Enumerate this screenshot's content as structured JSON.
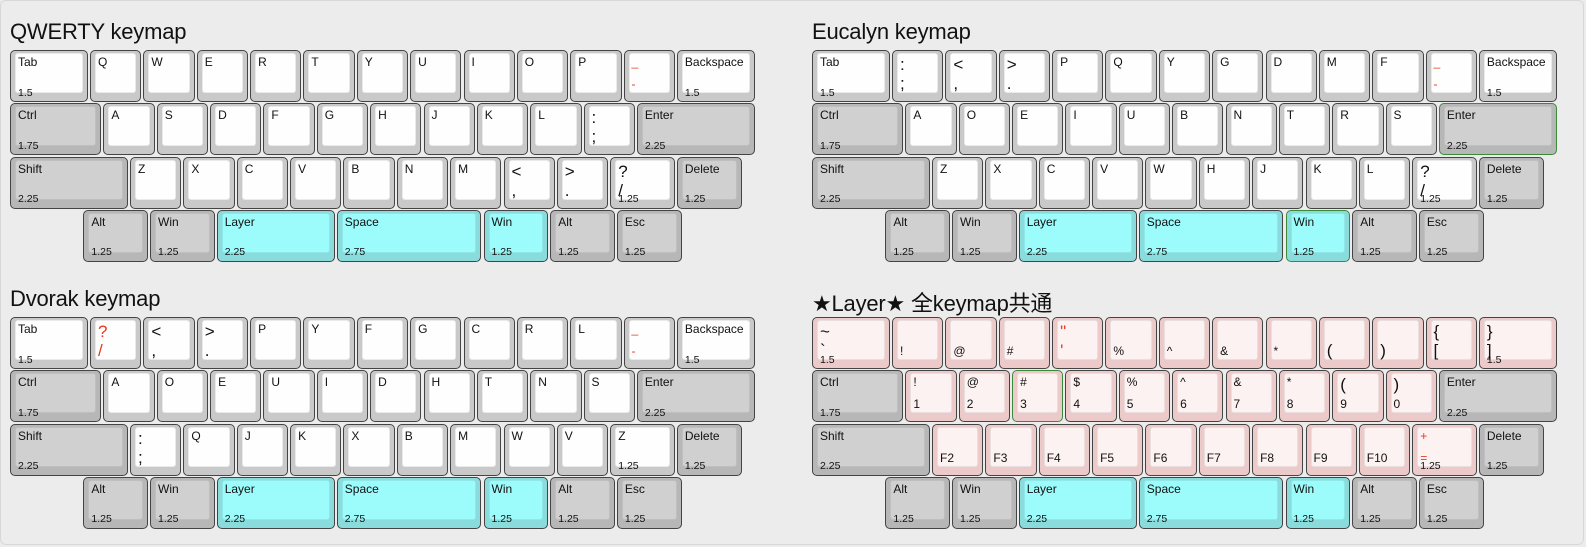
{
  "panels": [
    {
      "title": "QWERTY keymap",
      "rows": [
        [
          {
            "t": "Tab",
            "w": "1.5",
            "u": 1.5
          },
          {
            "t": "Q"
          },
          {
            "t": "W"
          },
          {
            "t": "E"
          },
          {
            "t": "R"
          },
          {
            "t": "T"
          },
          {
            "t": "Y"
          },
          {
            "t": "U"
          },
          {
            "t": "I"
          },
          {
            "t": "O"
          },
          {
            "t": "P"
          },
          {
            "t": "_",
            "b": "-",
            "red": true
          },
          {
            "t": "Backspace",
            "w": "1.5",
            "u": 1.5
          }
        ],
        [
          {
            "t": "Ctrl",
            "w": "1.75",
            "u": 1.75,
            "kind": "mod"
          },
          {
            "t": "A"
          },
          {
            "t": "S"
          },
          {
            "t": "D"
          },
          {
            "t": "F"
          },
          {
            "t": "G"
          },
          {
            "t": "H"
          },
          {
            "t": "J"
          },
          {
            "t": "K"
          },
          {
            "t": "L"
          },
          {
            "t": ":",
            "b": ";"
          },
          {
            "t": "Enter",
            "w": "2.25",
            "u": 2.25,
            "kind": "mod"
          }
        ],
        [
          {
            "t": "Shift",
            "w": "2.25",
            "u": 2.25,
            "kind": "mod"
          },
          {
            "t": "Z"
          },
          {
            "t": "X"
          },
          {
            "t": "C"
          },
          {
            "t": "V"
          },
          {
            "t": "B"
          },
          {
            "t": "N"
          },
          {
            "t": "M"
          },
          {
            "t": "<",
            "b": ","
          },
          {
            "t": ">",
            "b": "."
          },
          {
            "t": "?",
            "b": "/",
            "w": "1.25",
            "u": 1.25
          },
          {
            "t": "Delete",
            "w": "1.25",
            "u": 1.25,
            "kind": "mod"
          }
        ],
        [
          {
            "offset": 1.375
          },
          {
            "t": "Alt",
            "w": "1.25",
            "u": 1.25,
            "kind": "mod"
          },
          {
            "t": "Win",
            "w": "1.25",
            "u": 1.25,
            "kind": "mod"
          },
          {
            "t": "Layer",
            "w": "2.25",
            "u": 2.25,
            "kind": "layer"
          },
          {
            "t": "Space",
            "w": "2.75",
            "u": 2.75,
            "kind": "layer"
          },
          {
            "t": "Win",
            "w": "1.25",
            "u": 1.25,
            "kind": "layer"
          },
          {
            "t": "Alt",
            "w": "1.25",
            "u": 1.25,
            "kind": "mod"
          },
          {
            "t": "Esc",
            "w": "1.25",
            "u": 1.25,
            "kind": "mod"
          }
        ]
      ]
    },
    {
      "title": "Eucalyn keymap",
      "rows": [
        [
          {
            "t": "Tab",
            "w": "1.5",
            "u": 1.5
          },
          {
            "t": ":",
            "b": ";"
          },
          {
            "t": "<",
            "b": ","
          },
          {
            "t": ">",
            "b": "."
          },
          {
            "t": "P"
          },
          {
            "t": "Q"
          },
          {
            "t": "Y"
          },
          {
            "t": "G"
          },
          {
            "t": "D"
          },
          {
            "t": "M"
          },
          {
            "t": "F"
          },
          {
            "t": "_",
            "b": "-",
            "red": true
          },
          {
            "t": "Backspace",
            "w": "1.5",
            "u": 1.5
          }
        ],
        [
          {
            "t": "Ctrl",
            "w": "1.75",
            "u": 1.75,
            "kind": "mod"
          },
          {
            "t": "A"
          },
          {
            "t": "O"
          },
          {
            "t": "E"
          },
          {
            "t": "I"
          },
          {
            "t": "U"
          },
          {
            "t": "B"
          },
          {
            "t": "N"
          },
          {
            "t": "T"
          },
          {
            "t": "R"
          },
          {
            "t": "S"
          },
          {
            "t": "Enter",
            "w": "2.25",
            "u": 2.25,
            "kind": "mod",
            "hl": true
          }
        ],
        [
          {
            "t": "Shift",
            "w": "2.25",
            "u": 2.25,
            "kind": "mod"
          },
          {
            "t": "Z"
          },
          {
            "t": "X"
          },
          {
            "t": "C"
          },
          {
            "t": "V"
          },
          {
            "t": "W"
          },
          {
            "t": "H"
          },
          {
            "t": "J"
          },
          {
            "t": "K"
          },
          {
            "t": "L"
          },
          {
            "t": "?",
            "b": "/",
            "w": "1.25",
            "u": 1.25
          },
          {
            "t": "Delete",
            "w": "1.25",
            "u": 1.25,
            "kind": "mod"
          }
        ],
        [
          {
            "offset": 1.375
          },
          {
            "t": "Alt",
            "w": "1.25",
            "u": 1.25,
            "kind": "mod"
          },
          {
            "t": "Win",
            "w": "1.25",
            "u": 1.25,
            "kind": "mod"
          },
          {
            "t": "Layer",
            "w": "2.25",
            "u": 2.25,
            "kind": "layer"
          },
          {
            "t": "Space",
            "w": "2.75",
            "u": 2.75,
            "kind": "layer"
          },
          {
            "t": "Win",
            "w": "1.25",
            "u": 1.25,
            "kind": "layer",
            "hl": true
          },
          {
            "t": "Alt",
            "w": "1.25",
            "u": 1.25,
            "kind": "mod"
          },
          {
            "t": "Esc",
            "w": "1.25",
            "u": 1.25,
            "kind": "mod"
          }
        ]
      ]
    },
    {
      "title": "Dvorak keymap",
      "rows": [
        [
          {
            "t": "Tab",
            "w": "1.5",
            "u": 1.5
          },
          {
            "t": "?",
            "b": "/",
            "red": true
          },
          {
            "t": "<",
            "b": ","
          },
          {
            "t": ">",
            "b": "."
          },
          {
            "t": "P"
          },
          {
            "t": "Y"
          },
          {
            "t": "F"
          },
          {
            "t": "G"
          },
          {
            "t": "C"
          },
          {
            "t": "R"
          },
          {
            "t": "L"
          },
          {
            "t": "_",
            "b": "-",
            "red": true
          },
          {
            "t": "Backspace",
            "w": "1.5",
            "u": 1.5
          }
        ],
        [
          {
            "t": "Ctrl",
            "w": "1.75",
            "u": 1.75,
            "kind": "mod"
          },
          {
            "t": "A"
          },
          {
            "t": "O"
          },
          {
            "t": "E"
          },
          {
            "t": "U"
          },
          {
            "t": "I"
          },
          {
            "t": "D"
          },
          {
            "t": "H"
          },
          {
            "t": "T"
          },
          {
            "t": "N"
          },
          {
            "t": "S"
          },
          {
            "t": "Enter",
            "w": "2.25",
            "u": 2.25,
            "kind": "mod"
          }
        ],
        [
          {
            "t": "Shift",
            "w": "2.25",
            "u": 2.25,
            "kind": "mod"
          },
          {
            "t": ":",
            "b": ";"
          },
          {
            "t": "Q"
          },
          {
            "t": "J"
          },
          {
            "t": "K"
          },
          {
            "t": "X"
          },
          {
            "t": "B"
          },
          {
            "t": "M"
          },
          {
            "t": "W"
          },
          {
            "t": "V"
          },
          {
            "t": "Z",
            "w": "1.25",
            "u": 1.25
          },
          {
            "t": "Delete",
            "w": "1.25",
            "u": 1.25,
            "kind": "mod"
          }
        ],
        [
          {
            "offset": 1.375
          },
          {
            "t": "Alt",
            "w": "1.25",
            "u": 1.25,
            "kind": "mod"
          },
          {
            "t": "Win",
            "w": "1.25",
            "u": 1.25,
            "kind": "mod"
          },
          {
            "t": "Layer",
            "w": "2.25",
            "u": 2.25,
            "kind": "layer"
          },
          {
            "t": "Space",
            "w": "2.75",
            "u": 2.75,
            "kind": "layer"
          },
          {
            "t": "Win",
            "w": "1.25",
            "u": 1.25,
            "kind": "layer"
          },
          {
            "t": "Alt",
            "w": "1.25",
            "u": 1.25,
            "kind": "mod"
          },
          {
            "t": "Esc",
            "w": "1.25",
            "u": 1.25,
            "kind": "mod"
          }
        ]
      ]
    },
    {
      "title": "★Layer★ 全keymap共通",
      "rows": [
        [
          {
            "t": "~",
            "b": "`",
            "w": "1.5",
            "u": 1.5,
            "kind": "sym"
          },
          {
            "b": "!",
            "kind": "sym"
          },
          {
            "b": "@",
            "kind": "sym"
          },
          {
            "b": "#",
            "kind": "sym"
          },
          {
            "t": "\"",
            "b": "'",
            "kind": "sym",
            "red": true
          },
          {
            "b": "%",
            "kind": "sym"
          },
          {
            "b": "^",
            "kind": "sym"
          },
          {
            "b": "&",
            "kind": "sym"
          },
          {
            "b": "*",
            "kind": "sym"
          },
          {
            "b": "(",
            "kind": "sym"
          },
          {
            "b": ")",
            "kind": "sym"
          },
          {
            "t": "{",
            "b": "[",
            "kind": "sym"
          },
          {
            "t": "}",
            "b": "]",
            "w": "1.5",
            "u": 1.5,
            "kind": "sym"
          }
        ],
        [
          {
            "t": "Ctrl",
            "w": "1.75",
            "u": 1.75,
            "kind": "mod"
          },
          {
            "t": "!",
            "b": "1",
            "kind": "sym"
          },
          {
            "t": "@",
            "b": "2",
            "kind": "sym"
          },
          {
            "t": "#",
            "b": "3",
            "kind": "sym",
            "hl": true
          },
          {
            "t": "$",
            "b": "4",
            "kind": "sym"
          },
          {
            "t": "%",
            "b": "5",
            "kind": "sym"
          },
          {
            "t": "^",
            "b": "6",
            "kind": "sym"
          },
          {
            "t": "&",
            "b": "7",
            "kind": "sym"
          },
          {
            "t": "*",
            "b": "8",
            "kind": "sym"
          },
          {
            "t": "(",
            "b": "9",
            "kind": "sym"
          },
          {
            "t": ")",
            "b": "0",
            "kind": "sym"
          },
          {
            "t": "Enter",
            "w": "2.25",
            "u": 2.25,
            "kind": "mod"
          }
        ],
        [
          {
            "t": "Shift",
            "w": "2.25",
            "u": 2.25,
            "kind": "mod"
          },
          {
            "b": "F2",
            "kind": "sym"
          },
          {
            "b": "F3",
            "kind": "sym"
          },
          {
            "b": "F4",
            "kind": "sym"
          },
          {
            "b": "F5",
            "kind": "sym"
          },
          {
            "b": "F6",
            "kind": "sym"
          },
          {
            "b": "F7",
            "kind": "sym"
          },
          {
            "b": "F8",
            "kind": "sym"
          },
          {
            "b": "F9",
            "kind": "sym"
          },
          {
            "b": "F10",
            "kind": "sym"
          },
          {
            "t": "+",
            "b": "=",
            "w": "1.25",
            "u": 1.25,
            "kind": "sym",
            "red": true
          },
          {
            "t": "Delete",
            "w": "1.25",
            "u": 1.25,
            "kind": "mod"
          }
        ],
        [
          {
            "offset": 1.375
          },
          {
            "t": "Alt",
            "w": "1.25",
            "u": 1.25,
            "kind": "mod"
          },
          {
            "t": "Win",
            "w": "1.25",
            "u": 1.25,
            "kind": "mod"
          },
          {
            "t": "Layer",
            "w": "2.25",
            "u": 2.25,
            "kind": "layer"
          },
          {
            "t": "Space",
            "w": "2.75",
            "u": 2.75,
            "kind": "layer"
          },
          {
            "t": "Win",
            "w": "1.25",
            "u": 1.25,
            "kind": "layer"
          },
          {
            "t": "Alt",
            "w": "1.25",
            "u": 1.25,
            "kind": "mod"
          },
          {
            "t": "Esc",
            "w": "1.25",
            "u": 1.25,
            "kind": "mod"
          }
        ]
      ]
    }
  ]
}
